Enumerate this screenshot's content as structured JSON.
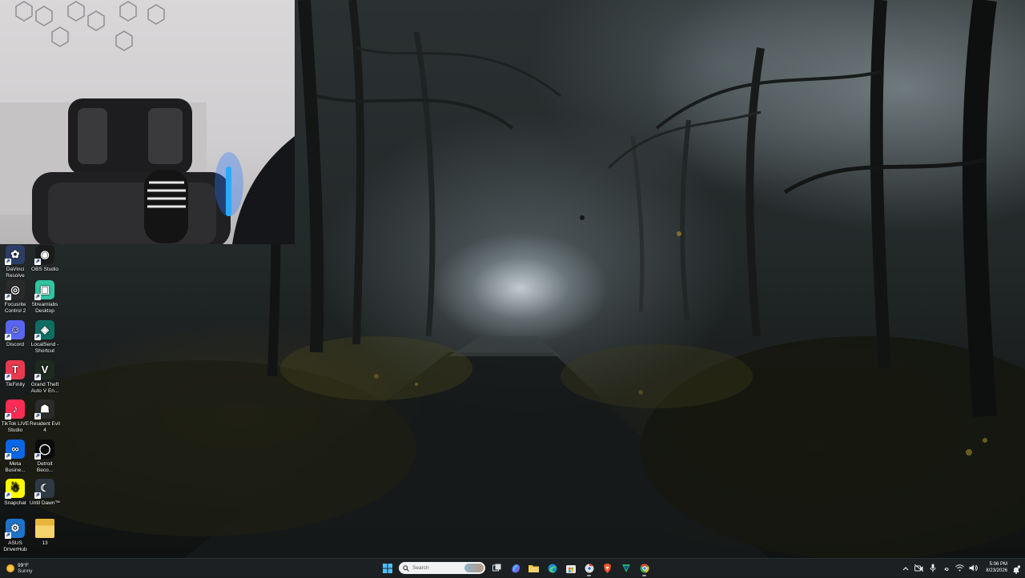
{
  "desktop_icons": [
    {
      "label": "DaVinci Resolve",
      "icon": "davinci-resolve-icon",
      "color": "#2c3e66"
    },
    {
      "label": "OBS Studio",
      "icon": "obs-studio-icon",
      "color": "#1b1b1b"
    },
    {
      "label": "Focusrite Control 2",
      "icon": "focusrite-icon",
      "color": "#2a2a2a"
    },
    {
      "label": "Streamlabs Desktop",
      "icon": "streamlabs-icon",
      "color": "#31c3a2"
    },
    {
      "label": "Discord",
      "icon": "discord-icon",
      "color": "#5865f2"
    },
    {
      "label": "LocalSend - Shortcut",
      "icon": "localsend-icon",
      "color": "#0f6e63"
    },
    {
      "label": "TikFinity",
      "icon": "tikfinity-icon",
      "color": "#e83a4f"
    },
    {
      "label": "Grand Theft Auto V En...",
      "icon": "gta-v-icon",
      "color": "#1e2a1e"
    },
    {
      "label": "TikTok LIVE Studio",
      "icon": "tiktok-live-icon",
      "color": "#fe2c55"
    },
    {
      "label": "Resident Evil 4",
      "icon": "resident-evil-4-icon",
      "color": "#2b2b2b"
    },
    {
      "label": "Meta Busine...",
      "icon": "meta-business-icon",
      "color": "#0a66e4"
    },
    {
      "label": "Detroit Beco...",
      "icon": "detroit-become-human-icon",
      "color": "#0b0b0b"
    },
    {
      "label": "Snapchat",
      "icon": "snapchat-icon",
      "color": "#fffc00"
    },
    {
      "label": "Until Dawn™",
      "icon": "until-dawn-icon",
      "color": "#2d3a44"
    },
    {
      "label": "ASUS DriverHub",
      "icon": "asus-driverhub-icon",
      "color": "#1d73c9"
    },
    {
      "label": "13",
      "icon": "folder-icon",
      "color": "#f2c94c"
    }
  ],
  "taskbar": {
    "weather": {
      "temp": "99°F",
      "condition": "Sunny"
    },
    "search_placeholder": "Search",
    "apps": [
      {
        "name": "task-view-icon"
      },
      {
        "name": "copilot-icon"
      },
      {
        "name": "file-explorer-icon"
      },
      {
        "name": "edge-icon"
      },
      {
        "name": "microsoft-store-icon"
      },
      {
        "name": "chrome-profile-icon"
      },
      {
        "name": "brave-icon"
      },
      {
        "name": "vpn-icon"
      },
      {
        "name": "chrome-icon"
      }
    ],
    "clock": {
      "time": "5:06 PM",
      "date": "8/23/2026"
    }
  },
  "colors": {
    "taskbar_bg": "#1c2022",
    "accent": "#0078d4"
  }
}
